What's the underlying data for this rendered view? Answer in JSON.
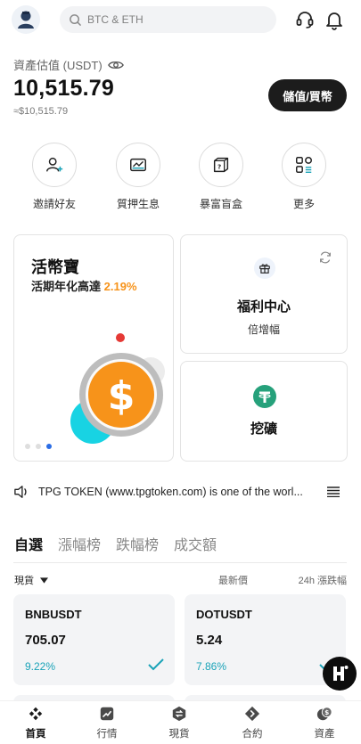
{
  "search": {
    "placeholder": "BTC & ETH"
  },
  "assets": {
    "label": "資產估值 (USDT)",
    "value": "10,515.79",
    "approx": "≈$10,515.79",
    "deposit_button": "儲值/買幣"
  },
  "quick_actions": [
    {
      "label": "邀請好友",
      "icon": "invite-friends-icon"
    },
    {
      "label": "質押生息",
      "icon": "staking-icon"
    },
    {
      "label": "暴富盲盒",
      "icon": "mystery-box-icon"
    },
    {
      "label": "更多",
      "icon": "more-grid-icon"
    }
  ],
  "earn_card": {
    "title": "活幣寶",
    "subtitle": "活期年化高達",
    "rate": "2.19%"
  },
  "welfare_card": {
    "title": "福利中心",
    "subtitle": "倍增幅"
  },
  "mining_card": {
    "title": "挖礦"
  },
  "news": {
    "text": "TPG TOKEN (www.tpgtoken.com) is one of the worl..."
  },
  "market_tabs": [
    "自選",
    "漲幅榜",
    "跌幅榜",
    "成交額"
  ],
  "market_header": {
    "spot": "現貨",
    "latest": "最新價",
    "change": "24h 漲跌幅"
  },
  "markets": [
    {
      "symbol": "BNBUSDT",
      "price": "705.07",
      "change": "9.22%"
    },
    {
      "symbol": "DOTUSDT",
      "price": "5.24",
      "change": "7.86%"
    }
  ],
  "bottom_nav": [
    {
      "label": "首頁",
      "icon": "home-icon"
    },
    {
      "label": "行情",
      "icon": "market-icon"
    },
    {
      "label": "現貨",
      "icon": "spot-icon"
    },
    {
      "label": "合約",
      "icon": "contract-icon"
    },
    {
      "label": "資產",
      "icon": "assets-icon"
    }
  ],
  "colors": {
    "accent_orange": "#f7931a",
    "positive_teal": "#1aa3b8",
    "tether_green": "#26a17b",
    "dark": "#1c1c1c"
  }
}
